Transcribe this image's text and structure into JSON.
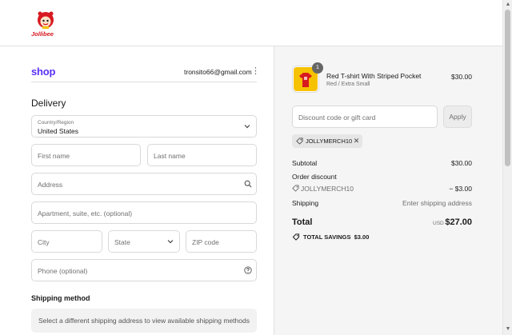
{
  "header": {
    "logo_text": "Jollibee"
  },
  "account": {
    "shop_label": "shop",
    "email": "tronsito66@gmail.com"
  },
  "delivery": {
    "title": "Delivery",
    "country_label": "Country/Region",
    "country_value": "United States",
    "first_name_placeholder": "First name",
    "last_name_placeholder": "Last name",
    "address_placeholder": "Address",
    "apartment_placeholder": "Apartment, suite, etc. (optional)",
    "city_placeholder": "City",
    "state_placeholder": "State",
    "zip_placeholder": "ZIP code",
    "phone_placeholder": "Phone (optional)"
  },
  "shipping": {
    "title": "Shipping method",
    "note": "Select a different shipping address to view available shipping methods"
  },
  "cart": {
    "item": {
      "name": "Red T-shirt With Striped Pocket",
      "variant": "Red / Extra Small",
      "price": "$30.00",
      "quantity": "1"
    },
    "discount_placeholder": "Discount code or gift card",
    "apply_label": "Apply",
    "applied_code": "JOLLYMERCH10"
  },
  "summary": {
    "subtotal_label": "Subtotal",
    "subtotal_value": "$30.00",
    "order_discount_label": "Order discount",
    "discount_code": "JOLLYMERCH10",
    "discount_value": "− $3.00",
    "shipping_label": "Shipping",
    "shipping_value": "Enter shipping address",
    "total_label": "Total",
    "total_currency": "USD",
    "total_value": "$27.00",
    "savings_label": "TOTAL SAVINGS",
    "savings_value": "$3.00"
  },
  "colors": {
    "shop_purple": "#5a31f4",
    "jollibee_red": "#d71920"
  }
}
